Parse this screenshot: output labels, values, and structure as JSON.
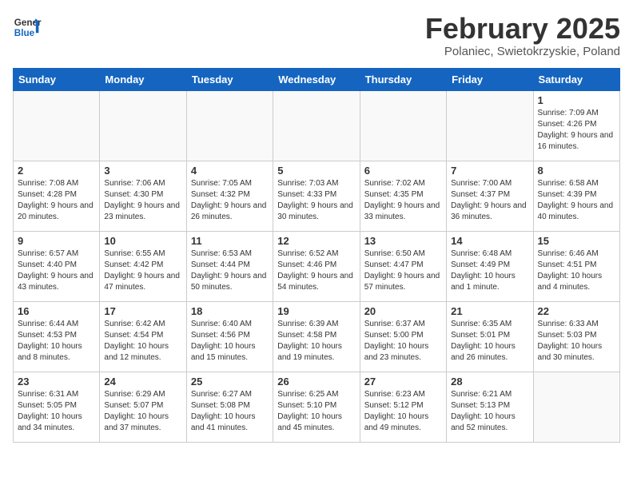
{
  "header": {
    "logo_line1": "General",
    "logo_line2": "Blue",
    "title": "February 2025",
    "subtitle": "Polaniec, Swietokrzyskie, Poland"
  },
  "weekdays": [
    "Sunday",
    "Monday",
    "Tuesday",
    "Wednesday",
    "Thursday",
    "Friday",
    "Saturday"
  ],
  "weeks": [
    [
      {
        "day": "",
        "info": ""
      },
      {
        "day": "",
        "info": ""
      },
      {
        "day": "",
        "info": ""
      },
      {
        "day": "",
        "info": ""
      },
      {
        "day": "",
        "info": ""
      },
      {
        "day": "",
        "info": ""
      },
      {
        "day": "1",
        "info": "Sunrise: 7:09 AM\nSunset: 4:26 PM\nDaylight: 9 hours and 16 minutes."
      }
    ],
    [
      {
        "day": "2",
        "info": "Sunrise: 7:08 AM\nSunset: 4:28 PM\nDaylight: 9 hours and 20 minutes."
      },
      {
        "day": "3",
        "info": "Sunrise: 7:06 AM\nSunset: 4:30 PM\nDaylight: 9 hours and 23 minutes."
      },
      {
        "day": "4",
        "info": "Sunrise: 7:05 AM\nSunset: 4:32 PM\nDaylight: 9 hours and 26 minutes."
      },
      {
        "day": "5",
        "info": "Sunrise: 7:03 AM\nSunset: 4:33 PM\nDaylight: 9 hours and 30 minutes."
      },
      {
        "day": "6",
        "info": "Sunrise: 7:02 AM\nSunset: 4:35 PM\nDaylight: 9 hours and 33 minutes."
      },
      {
        "day": "7",
        "info": "Sunrise: 7:00 AM\nSunset: 4:37 PM\nDaylight: 9 hours and 36 minutes."
      },
      {
        "day": "8",
        "info": "Sunrise: 6:58 AM\nSunset: 4:39 PM\nDaylight: 9 hours and 40 minutes."
      }
    ],
    [
      {
        "day": "9",
        "info": "Sunrise: 6:57 AM\nSunset: 4:40 PM\nDaylight: 9 hours and 43 minutes."
      },
      {
        "day": "10",
        "info": "Sunrise: 6:55 AM\nSunset: 4:42 PM\nDaylight: 9 hours and 47 minutes."
      },
      {
        "day": "11",
        "info": "Sunrise: 6:53 AM\nSunset: 4:44 PM\nDaylight: 9 hours and 50 minutes."
      },
      {
        "day": "12",
        "info": "Sunrise: 6:52 AM\nSunset: 4:46 PM\nDaylight: 9 hours and 54 minutes."
      },
      {
        "day": "13",
        "info": "Sunrise: 6:50 AM\nSunset: 4:47 PM\nDaylight: 9 hours and 57 minutes."
      },
      {
        "day": "14",
        "info": "Sunrise: 6:48 AM\nSunset: 4:49 PM\nDaylight: 10 hours and 1 minute."
      },
      {
        "day": "15",
        "info": "Sunrise: 6:46 AM\nSunset: 4:51 PM\nDaylight: 10 hours and 4 minutes."
      }
    ],
    [
      {
        "day": "16",
        "info": "Sunrise: 6:44 AM\nSunset: 4:53 PM\nDaylight: 10 hours and 8 minutes."
      },
      {
        "day": "17",
        "info": "Sunrise: 6:42 AM\nSunset: 4:54 PM\nDaylight: 10 hours and 12 minutes."
      },
      {
        "day": "18",
        "info": "Sunrise: 6:40 AM\nSunset: 4:56 PM\nDaylight: 10 hours and 15 minutes."
      },
      {
        "day": "19",
        "info": "Sunrise: 6:39 AM\nSunset: 4:58 PM\nDaylight: 10 hours and 19 minutes."
      },
      {
        "day": "20",
        "info": "Sunrise: 6:37 AM\nSunset: 5:00 PM\nDaylight: 10 hours and 23 minutes."
      },
      {
        "day": "21",
        "info": "Sunrise: 6:35 AM\nSunset: 5:01 PM\nDaylight: 10 hours and 26 minutes."
      },
      {
        "day": "22",
        "info": "Sunrise: 6:33 AM\nSunset: 5:03 PM\nDaylight: 10 hours and 30 minutes."
      }
    ],
    [
      {
        "day": "23",
        "info": "Sunrise: 6:31 AM\nSunset: 5:05 PM\nDaylight: 10 hours and 34 minutes."
      },
      {
        "day": "24",
        "info": "Sunrise: 6:29 AM\nSunset: 5:07 PM\nDaylight: 10 hours and 37 minutes."
      },
      {
        "day": "25",
        "info": "Sunrise: 6:27 AM\nSunset: 5:08 PM\nDaylight: 10 hours and 41 minutes."
      },
      {
        "day": "26",
        "info": "Sunrise: 6:25 AM\nSunset: 5:10 PM\nDaylight: 10 hours and 45 minutes."
      },
      {
        "day": "27",
        "info": "Sunrise: 6:23 AM\nSunset: 5:12 PM\nDaylight: 10 hours and 49 minutes."
      },
      {
        "day": "28",
        "info": "Sunrise: 6:21 AM\nSunset: 5:13 PM\nDaylight: 10 hours and 52 minutes."
      },
      {
        "day": "",
        "info": ""
      }
    ]
  ]
}
